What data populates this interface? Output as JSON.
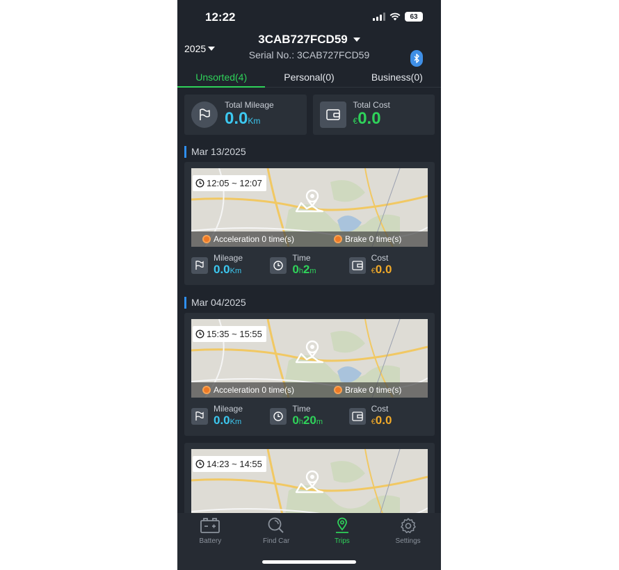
{
  "status_bar": {
    "time": "12:22",
    "battery": "63"
  },
  "header": {
    "year": "2025",
    "device_name": "3CAB727FCD59",
    "serial_label": "Serial No.: 3CAB727FCD59"
  },
  "tabs": [
    {
      "label": "Unsorted(4)",
      "active": true
    },
    {
      "label": "Personal(0)",
      "active": false
    },
    {
      "label": "Business(0)",
      "active": false
    }
  ],
  "summary": {
    "mileage_label": "Total Mileage",
    "mileage_value": "0.0",
    "mileage_unit": "Km",
    "cost_label": "Total Cost",
    "cost_currency": "€",
    "cost_value": "0.0"
  },
  "trips": [
    {
      "date": "Mar 13/2025",
      "time_range": "12:05 ~ 12:07",
      "acceleration": "Acceleration 0 time(s)",
      "brake": "Brake 0 time(s)",
      "mileage_label": "Mileage",
      "mileage_value": "0.0",
      "mileage_unit": "Km",
      "time_label": "Time",
      "time_h": "0",
      "time_h_unit": "h",
      "time_m": "2",
      "time_m_unit": "m",
      "cost_label": "Cost",
      "cost_currency": "€",
      "cost_value": "0.0"
    },
    {
      "date": "Mar 04/2025",
      "time_range": "15:35 ~ 15:55",
      "acceleration": "Acceleration 0 time(s)",
      "brake": "Brake 0 time(s)",
      "mileage_label": "Mileage",
      "mileage_value": "0.0",
      "mileage_unit": "Km",
      "time_label": "Time",
      "time_h": "0",
      "time_h_unit": "h",
      "time_m": "20",
      "time_m_unit": "m",
      "cost_label": "Cost",
      "cost_currency": "€",
      "cost_value": "0.0"
    },
    {
      "time_range": "14:23 ~ 14:55"
    }
  ],
  "bottom_nav": [
    {
      "label": "Battery",
      "icon": "battery-icon",
      "active": false
    },
    {
      "label": "Find Car",
      "icon": "search-icon",
      "active": false
    },
    {
      "label": "Trips",
      "icon": "location-pin-icon",
      "active": true
    },
    {
      "label": "Settings",
      "icon": "gear-icon",
      "active": false
    }
  ],
  "colors": {
    "background": "#1f242c",
    "card": "#2a3038",
    "accent_green": "#2fd25a",
    "accent_cyan": "#3cc8f0",
    "accent_orange": "#f0a929",
    "date_marker": "#2f8ff0"
  }
}
